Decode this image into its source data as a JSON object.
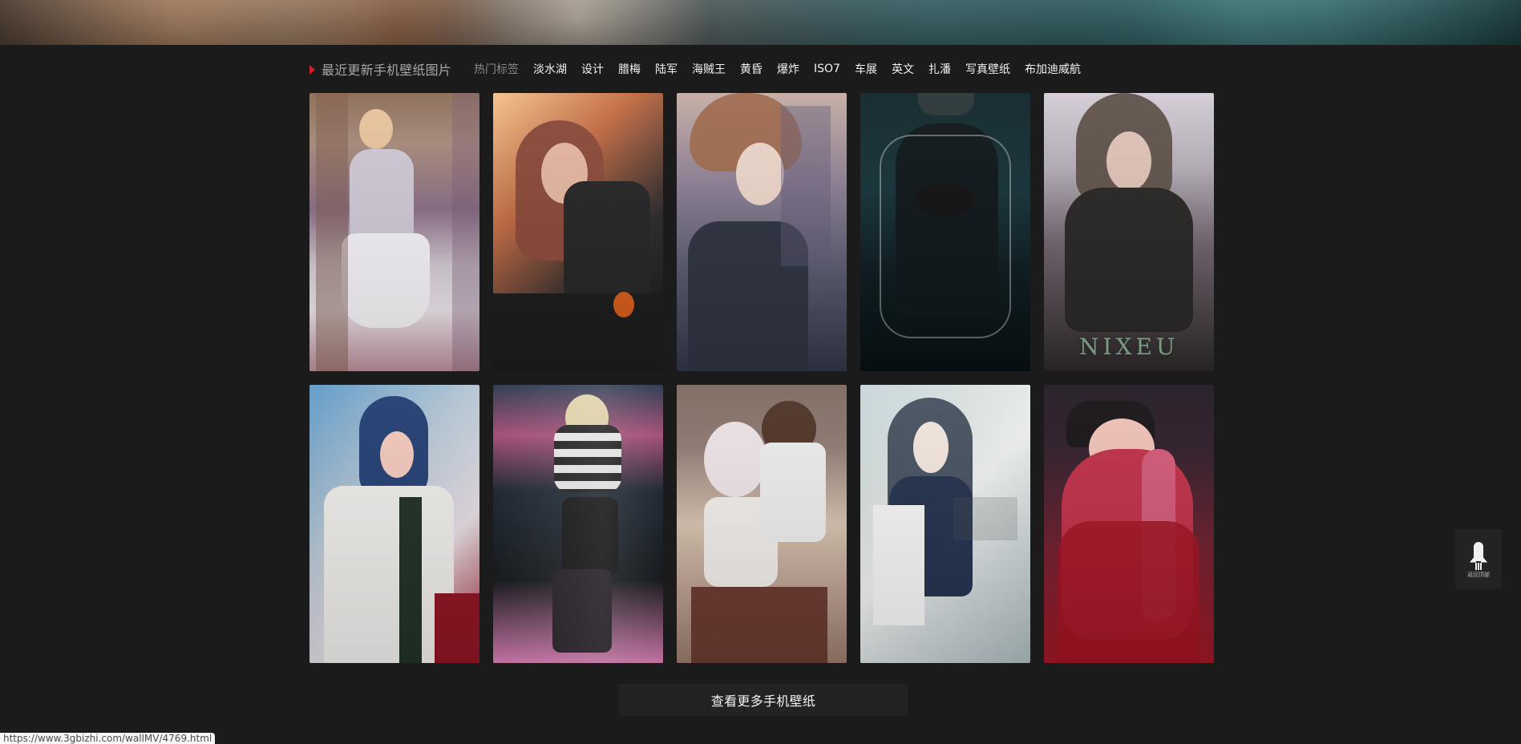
{
  "header": {
    "section_title": "最近更新手机壁纸图片",
    "hot_tags_label": "热门标签",
    "tags": [
      "淡水湖",
      "设计",
      "腊梅",
      "陆军",
      "海贼王",
      "黄昏",
      "爆炸",
      "ISO7",
      "车展",
      "英文",
      "扎潘",
      "写真壁纸",
      "布加迪威航"
    ]
  },
  "gallery": {
    "watermark_text": "NIXEU"
  },
  "actions": {
    "more_button": "查看更多手机壁纸",
    "back_to_top": "返回顶部"
  },
  "status": {
    "url": "https://www.3gbizhi.com/wallMV/4769.html"
  }
}
